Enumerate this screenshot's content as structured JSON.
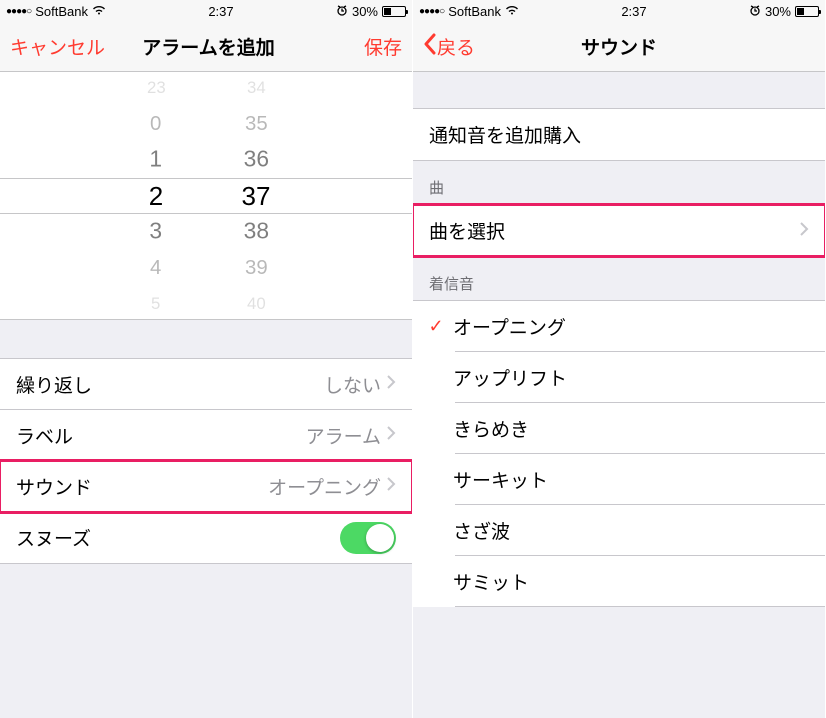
{
  "status": {
    "carrier": "SoftBank",
    "time": "2:37",
    "battery_pct": "30%",
    "signal_dots": "●●●●○"
  },
  "left_screen": {
    "nav": {
      "cancel": "キャンセル",
      "title": "アラームを追加",
      "save": "保存"
    },
    "picker": {
      "hours": {
        "m3": "23",
        "m2": "0",
        "m1": "1",
        "sel": "2",
        "p1": "3",
        "p2": "4",
        "p3": "5"
      },
      "minutes": {
        "m3": "34",
        "m2": "35",
        "m1": "36",
        "sel": "37",
        "p1": "38",
        "p2": "39",
        "p3": "40"
      }
    },
    "rows": {
      "repeat": {
        "label": "繰り返し",
        "value": "しない"
      },
      "label_row": {
        "label": "ラベル",
        "value": "アラーム"
      },
      "sound": {
        "label": "サウンド",
        "value": "オープニング"
      },
      "snooze": {
        "label": "スヌーズ"
      }
    }
  },
  "right_screen": {
    "nav": {
      "back": "戻る",
      "title": "サウンド"
    },
    "store": {
      "buy_more": "通知音を追加購入"
    },
    "song_section": {
      "header": "曲",
      "pick_song": "曲を選択"
    },
    "ringtone_section": {
      "header": "着信音",
      "tones": [
        "オープニング",
        "アップリフト",
        "きらめき",
        "サーキット",
        "さざ波",
        "サミット"
      ],
      "selected_index": 0
    }
  }
}
